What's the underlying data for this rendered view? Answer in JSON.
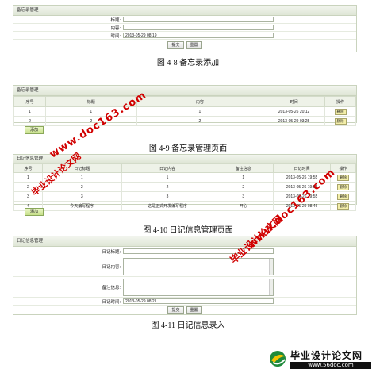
{
  "panel1": {
    "title": "备忘录管理",
    "fields": [
      {
        "label": "标题:",
        "value": ""
      },
      {
        "label": "内容:",
        "value": ""
      },
      {
        "label": "时间:",
        "value": "2013-05-29 08:19"
      }
    ],
    "submit": "提交",
    "reset": "重置"
  },
  "caption1": "图 4-8 备忘录添加",
  "panel2": {
    "title": "备忘录管理",
    "headers": [
      "序号",
      "标题",
      "内容",
      "时间",
      "操作"
    ],
    "rows": [
      [
        "1",
        "1",
        "1",
        "2013-05-26 20:12",
        "删除"
      ],
      [
        "2",
        "2",
        "2",
        "2013-05-29 03:25",
        "删除"
      ]
    ],
    "add": "添加"
  },
  "caption2": "图 4-9 备忘录管理页面",
  "panel3": {
    "title": "日记信息管理",
    "headers": [
      "序号",
      "日记标题",
      "日记内容",
      "备注信息",
      "日记时间",
      "操作"
    ],
    "rows": [
      [
        "1",
        "1",
        "1",
        "1",
        "2013-05-26 19:55",
        "删除"
      ],
      [
        "2",
        "2",
        "2",
        "2",
        "2013-05-26 19:55",
        "删除"
      ],
      [
        "3",
        "3",
        "3",
        "3",
        "2013-05-26 19:55",
        "删除"
      ],
      [
        "4",
        "今天编写程序",
        "这是正式开发编写程序",
        "开心",
        "2013-05-29 08:46",
        "删除"
      ]
    ],
    "add": "添加"
  },
  "caption3": "图 4-10 日记信息管理页面",
  "panel4": {
    "title": "日记信息管理",
    "fields": [
      {
        "label": "日记标题:",
        "value": ""
      },
      {
        "label": "日记内容:",
        "value": ""
      },
      {
        "label": "备注信息:",
        "value": ""
      },
      {
        "label": "日记时间:",
        "value": "2013-05-29 08:21"
      }
    ],
    "submit": "提交",
    "reset": "重置"
  },
  "caption4": "图 4-11 日记信息录入",
  "watermarks": {
    "site1": "www.doc163.com",
    "name1": "毕业设计论文网",
    "site2": "www.doc163.com",
    "name2": "毕业设计论文网",
    "logo_name": "毕业设计论文网",
    "logo_site": "www.56doc.com"
  },
  "colors": {
    "watermark": "#d10000",
    "panel_border": "#c9d3bd",
    "delete_btn": "#f3eea9"
  }
}
